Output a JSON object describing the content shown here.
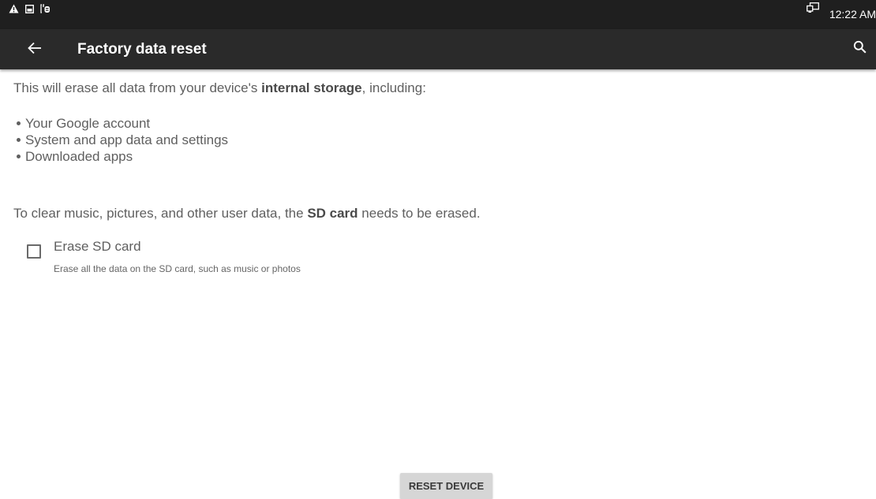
{
  "status_bar": {
    "time": "12:22 AM",
    "icons": [
      "warning-icon",
      "screenshot-icon",
      "usb-debug-icon",
      "cast-icon"
    ]
  },
  "toolbar": {
    "title": "Factory data reset",
    "back_icon": "arrow-back-icon",
    "search_icon": "search-icon"
  },
  "content": {
    "intro_before": "This will erase all data from your device's ",
    "intro_bold": "internal storage",
    "intro_after": ", including:",
    "bullets": [
      "Your Google account",
      "System and app data and settings",
      "Downloaded apps"
    ],
    "sd_before": "To clear music, pictures, and other user data, the ",
    "sd_bold": "SD card",
    "sd_after": " needs to be erased."
  },
  "erase_sd": {
    "label": "Erase SD card",
    "summary": "Erase all the data on the SD card, such as music or photos",
    "checked": false
  },
  "reset_button": {
    "label": "RESET DEVICE"
  },
  "colors": {
    "status_bar_bg": "#1f1f1f",
    "toolbar_bg": "#2a2a2a",
    "body_text": "#5f5f5f",
    "button_bg": "#d6d6d6"
  }
}
